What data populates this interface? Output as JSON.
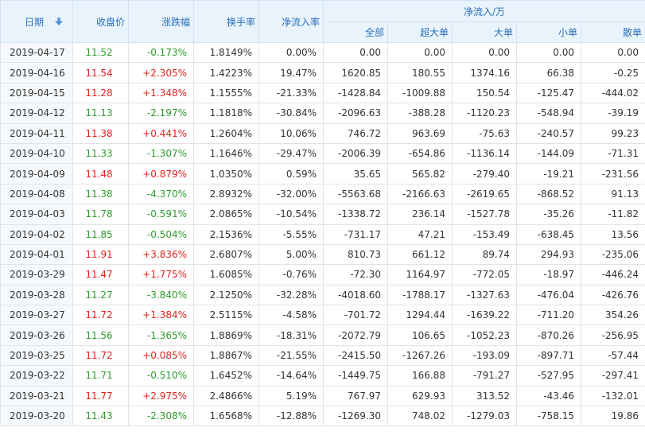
{
  "header": {
    "date": "日期",
    "close": "收盘价",
    "change": "涨跌幅",
    "turnover": "换手率",
    "net_rate": "净流入率",
    "net_group": "净流入/万",
    "all": "全部",
    "super_large": "超大单",
    "large": "大单",
    "small": "小单",
    "retail": "散单"
  },
  "icons": {
    "sort": "sort-down-arrow-icon"
  },
  "colors": {
    "up": "#e0231f",
    "down": "#2e9a2e",
    "header_text": "#2a6fb8",
    "header_bg": "#e9f3fc"
  },
  "rows": [
    {
      "date": "2019-04-17",
      "close": "11.52",
      "change": "-0.173%",
      "turnover": "1.8149%",
      "net_rate": "0.00%",
      "all": "0.00",
      "super_large": "0.00",
      "large": "0.00",
      "small": "0.00",
      "retail": "0.00"
    },
    {
      "date": "2019-04-16",
      "close": "11.54",
      "change": "+2.305%",
      "turnover": "1.4223%",
      "net_rate": "19.47%",
      "all": "1620.85",
      "super_large": "180.55",
      "large": "1374.16",
      "small": "66.38",
      "retail": "-0.25"
    },
    {
      "date": "2019-04-15",
      "close": "11.28",
      "change": "+1.348%",
      "turnover": "1.1555%",
      "net_rate": "-21.33%",
      "all": "-1428.84",
      "super_large": "-1009.88",
      "large": "150.54",
      "small": "-125.47",
      "retail": "-444.02"
    },
    {
      "date": "2019-04-12",
      "close": "11.13",
      "change": "-2.197%",
      "turnover": "1.1818%",
      "net_rate": "-30.84%",
      "all": "-2096.63",
      "super_large": "-388.28",
      "large": "-1120.23",
      "small": "-548.94",
      "retail": "-39.19"
    },
    {
      "date": "2019-04-11",
      "close": "11.38",
      "change": "+0.441%",
      "turnover": "1.2604%",
      "net_rate": "10.06%",
      "all": "746.72",
      "super_large": "963.69",
      "large": "-75.63",
      "small": "-240.57",
      "retail": "99.23"
    },
    {
      "date": "2019-04-10",
      "close": "11.33",
      "change": "-1.307%",
      "turnover": "1.1646%",
      "net_rate": "-29.47%",
      "all": "-2006.39",
      "super_large": "-654.86",
      "large": "-1136.14",
      "small": "-144.09",
      "retail": "-71.31"
    },
    {
      "date": "2019-04-09",
      "close": "11.48",
      "change": "+0.879%",
      "turnover": "1.0350%",
      "net_rate": "0.59%",
      "all": "35.65",
      "super_large": "565.82",
      "large": "-279.40",
      "small": "-19.21",
      "retail": "-231.56"
    },
    {
      "date": "2019-04-08",
      "close": "11.38",
      "change": "-4.370%",
      "turnover": "2.8932%",
      "net_rate": "-32.00%",
      "all": "-5563.68",
      "super_large": "-2166.63",
      "large": "-2619.65",
      "small": "-868.52",
      "retail": "91.13"
    },
    {
      "date": "2019-04-03",
      "close": "11.78",
      "change": "-0.591%",
      "turnover": "2.0865%",
      "net_rate": "-10.54%",
      "all": "-1338.72",
      "super_large": "236.14",
      "large": "-1527.78",
      "small": "-35.26",
      "retail": "-11.82"
    },
    {
      "date": "2019-04-02",
      "close": "11.85",
      "change": "-0.504%",
      "turnover": "2.1536%",
      "net_rate": "-5.55%",
      "all": "-731.17",
      "super_large": "47.21",
      "large": "-153.49",
      "small": "-638.45",
      "retail": "13.56"
    },
    {
      "date": "2019-04-01",
      "close": "11.91",
      "change": "+3.836%",
      "turnover": "2.6807%",
      "net_rate": "5.00%",
      "all": "810.73",
      "super_large": "661.12",
      "large": "89.74",
      "small": "294.93",
      "retail": "-235.06"
    },
    {
      "date": "2019-03-29",
      "close": "11.47",
      "change": "+1.775%",
      "turnover": "1.6085%",
      "net_rate": "-0.76%",
      "all": "-72.30",
      "super_large": "1164.97",
      "large": "-772.05",
      "small": "-18.97",
      "retail": "-446.24"
    },
    {
      "date": "2019-03-28",
      "close": "11.27",
      "change": "-3.840%",
      "turnover": "2.1250%",
      "net_rate": "-32.28%",
      "all": "-4018.60",
      "super_large": "-1788.17",
      "large": "-1327.63",
      "small": "-476.04",
      "retail": "-426.76"
    },
    {
      "date": "2019-03-27",
      "close": "11.72",
      "change": "+1.384%",
      "turnover": "2.5115%",
      "net_rate": "-4.58%",
      "all": "-701.72",
      "super_large": "1294.44",
      "large": "-1639.22",
      "small": "-711.20",
      "retail": "354.26"
    },
    {
      "date": "2019-03-26",
      "close": "11.56",
      "change": "-1.365%",
      "turnover": "1.8869%",
      "net_rate": "-18.31%",
      "all": "-2072.79",
      "super_large": "106.65",
      "large": "-1052.23",
      "small": "-870.26",
      "retail": "-256.95"
    },
    {
      "date": "2019-03-25",
      "close": "11.72",
      "change": "+0.085%",
      "turnover": "1.8867%",
      "net_rate": "-21.55%",
      "all": "-2415.50",
      "super_large": "-1267.26",
      "large": "-193.09",
      "small": "-897.71",
      "retail": "-57.44"
    },
    {
      "date": "2019-03-22",
      "close": "11.71",
      "change": "-0.510%",
      "turnover": "1.6452%",
      "net_rate": "-14.64%",
      "all": "-1449.75",
      "super_large": "166.88",
      "large": "-791.27",
      "small": "-527.95",
      "retail": "-297.41"
    },
    {
      "date": "2019-03-21",
      "close": "11.77",
      "change": "+2.975%",
      "turnover": "2.4866%",
      "net_rate": "5.19%",
      "all": "767.97",
      "super_large": "629.93",
      "large": "313.52",
      "small": "-43.46",
      "retail": "-132.01"
    },
    {
      "date": "2019-03-20",
      "close": "11.43",
      "change": "-2.308%",
      "turnover": "1.6568%",
      "net_rate": "-12.88%",
      "all": "-1269.30",
      "super_large": "748.02",
      "large": "-1279.03",
      "small": "-758.15",
      "retail": "19.86"
    }
  ]
}
